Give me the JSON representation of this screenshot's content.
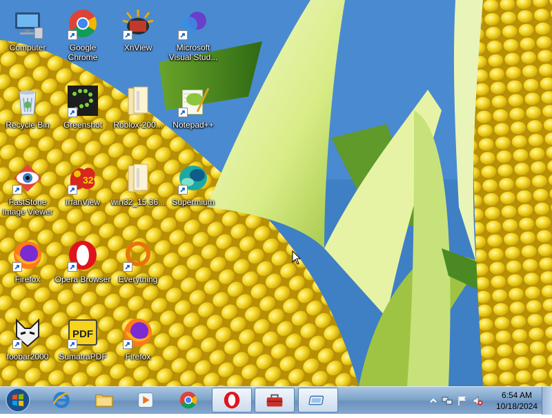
{
  "desktop": {
    "icons": [
      {
        "label": "Computer"
      },
      {
        "label": "Google Chrome"
      },
      {
        "label": "XnView"
      },
      {
        "label": "Microsoft Visual Stud..."
      },
      {
        "label": "Recycle Bin"
      },
      {
        "label": "Greenshot"
      },
      {
        "label": "Roblox-200..."
      },
      {
        "label": "Notepad++"
      },
      {
        "label": "FastStone Image Viewer"
      },
      {
        "label": "IrfanView"
      },
      {
        "label": "win32_15.36..."
      },
      {
        "label": "Supermium"
      },
      {
        "label": "Firefox"
      },
      {
        "label": "Opera Browser"
      },
      {
        "label": "Everything"
      },
      {
        "label": "foobar2000"
      },
      {
        "label": "SumatraPDF"
      },
      {
        "label": "Firefox"
      }
    ]
  },
  "taskbar": {
    "pinned": [
      "internet-explorer",
      "file-explorer",
      "media-player",
      "chrome",
      "opera",
      "toolbox",
      "display-settings"
    ],
    "active_item": "opera",
    "clock": {
      "time": "6:54 AM",
      "date": "10/18/2024"
    }
  },
  "colors": {
    "taskbar": "#7fa4cb",
    "sky": "#3f7fc4",
    "corn": "#f4d21a"
  }
}
